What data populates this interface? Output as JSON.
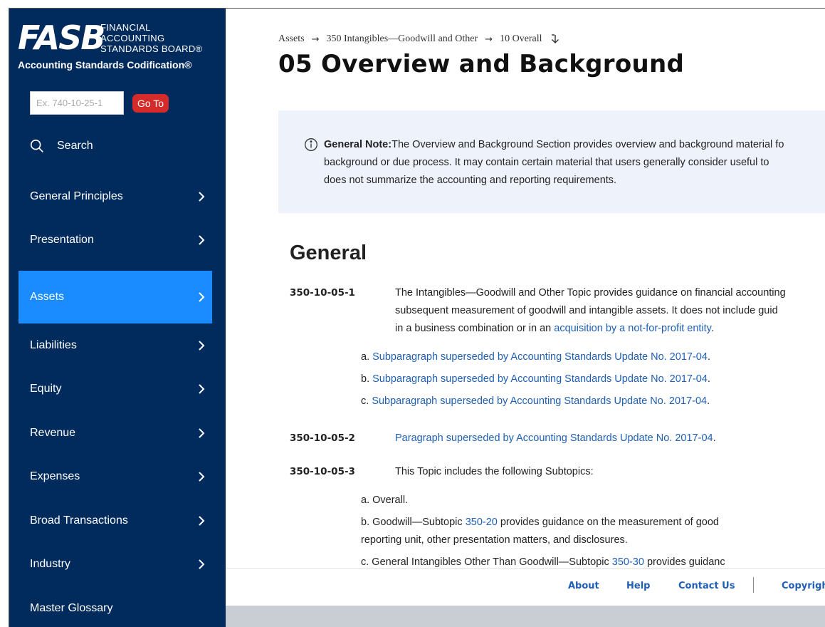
{
  "brand": {
    "mark": "FASB",
    "org_lines": [
      "Financial",
      "Accounting",
      "Standards Board®"
    ],
    "subtitle": "Accounting Standards Codification®"
  },
  "goto": {
    "placeholder": "Ex. 740-10-25-1",
    "button_label": "Go To"
  },
  "search": {
    "label": "Search"
  },
  "nav": [
    {
      "label": "General Principles",
      "active": false
    },
    {
      "label": "Presentation",
      "active": false
    },
    {
      "label": "Assets",
      "active": true
    },
    {
      "label": "Liabilities",
      "active": false
    },
    {
      "label": "Equity",
      "active": false
    },
    {
      "label": "Revenue",
      "active": false
    },
    {
      "label": "Expenses",
      "active": false
    },
    {
      "label": "Broad Transactions",
      "active": false
    },
    {
      "label": "Industry",
      "active": false
    },
    {
      "label": "Master Glossary",
      "active": false
    }
  ],
  "breadcrumb": [
    "Assets",
    "350 Intangibles—Goodwill and Other",
    "10 Overall"
  ],
  "page_title": "05 Overview and Background",
  "note": {
    "label": "General Note:",
    "lines": [
      "The Overview and Background Section provides overview and background material fo",
      "background or due process. It may contain certain material that users generally consider useful to",
      "does not summarize the accounting and reporting requirements."
    ]
  },
  "section_heading": "General",
  "paragraphs": {
    "p1": {
      "number": "350-10-05-1",
      "line1": "The Intangibles—Goodwill and Other Topic provides guidance on financial accounting",
      "line2": "subsequent measurement of goodwill and intangible assets. It does not include guid",
      "line3_pre": "in a business combination or in an ",
      "line3_link": "acquisition by a not-for-profit entity",
      "line3_post": ".",
      "subs": [
        {
          "letter": "a.",
          "text": "Subparagraph superseded by Accounting Standards Update No. 2017-04"
        },
        {
          "letter": "b.",
          "text": "Subparagraph superseded by Accounting Standards Update No. 2017-04"
        },
        {
          "letter": "c.",
          "text": "Subparagraph superseded by Accounting Standards Update No. 2017-04"
        }
      ]
    },
    "p2": {
      "number": "350-10-05-2",
      "link": "Paragraph superseded by Accounting Standards Update No. 2017-04"
    },
    "p3": {
      "number": "350-10-05-3",
      "text": "This Topic includes the following Subtopics:",
      "sub_a": "a. Overall.",
      "sub_b_pre": "b. Goodwill—Subtopic ",
      "sub_b_link": "350-20",
      "sub_b_post": " provides guidance on the measurement of good",
      "sub_b_line2": "reporting unit, other presentation matters, and disclosures.",
      "sub_c_pre": "c. General Intangibles Other Than Goodwill—Subtopic ",
      "sub_c_link": "350-30",
      "sub_c_post": " provides guidanc"
    }
  },
  "footer": {
    "links": [
      "About",
      "Help",
      "Contact Us",
      "Copyright"
    ]
  },
  "colors": {
    "sidebar_bg": "#002b5c",
    "active_nav": "#1a8cff",
    "goto_button": "#d62b2b",
    "link": "#1f5fb5",
    "note_bg": "#eef3fb"
  }
}
